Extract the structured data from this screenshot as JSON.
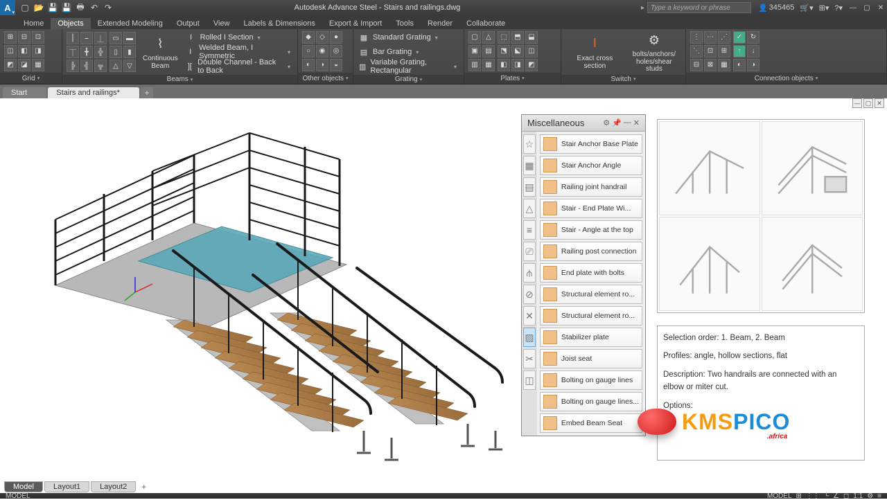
{
  "app": {
    "title": "Autodesk Advance Steel - Stairs and railings.dwg",
    "search_placeholder": "Type a keyword or phrase",
    "user_count": "345465"
  },
  "menu": {
    "tabs": [
      "Home",
      "Objects",
      "Extended Modeling",
      "Output",
      "View",
      "Labels & Dimensions",
      "Export & Import",
      "Tools",
      "Render",
      "Collaborate"
    ],
    "active": "Objects"
  },
  "ribbon": {
    "groups": {
      "grid": "Grid",
      "beams": "Beams",
      "other": "Other objects",
      "grating": "Grating",
      "plates": "Plates",
      "switch": "Switch",
      "conn": "Connection objects"
    },
    "cont_beam": "Continuous\nBeam",
    "beam_rows": [
      "Rolled I Section",
      "Welded Beam, I Symmetric",
      "Double Channel - Back to Back"
    ],
    "grating_rows": [
      "Standard Grating",
      "Bar Grating",
      "Variable Grating, Rectangular"
    ],
    "switch_btns": {
      "exact": "Exact cross section",
      "bolts": "bolts/anchors/\nholes/shear studs"
    }
  },
  "doc_tabs": {
    "start": "Start",
    "file": "Stairs and railings*"
  },
  "palette": {
    "title": "Miscellaneous",
    "items": [
      "Stair Anchor Base Plate",
      "Stair Anchor Angle",
      "Railing joint handrail",
      "Stair - End Plate Wi...",
      "Stair - Angle at the top",
      "Railing post connection",
      "End plate with bolts",
      "Structural element ro...",
      "Structural element ro...",
      "Stabilizer plate",
      "Joist seat",
      "Bolting on gauge lines",
      "Bolting on gauge lines...",
      "Embed Beam Seat"
    ]
  },
  "info": {
    "line1": "Selection order: 1. Beam, 2. Beam",
    "line2": "Profiles: angle, hollow sections, flat",
    "line3": "Description: Two handrails are connected with an elbow or miter cut.",
    "line4": "Options:"
  },
  "watermark": {
    "text": "KMSPICO",
    "suffix": ".africa"
  },
  "bottom": {
    "model": "Model",
    "l1": "Layout1",
    "l2": "Layout2"
  },
  "status": {
    "model": "MODEL",
    "scale": "1:1"
  }
}
